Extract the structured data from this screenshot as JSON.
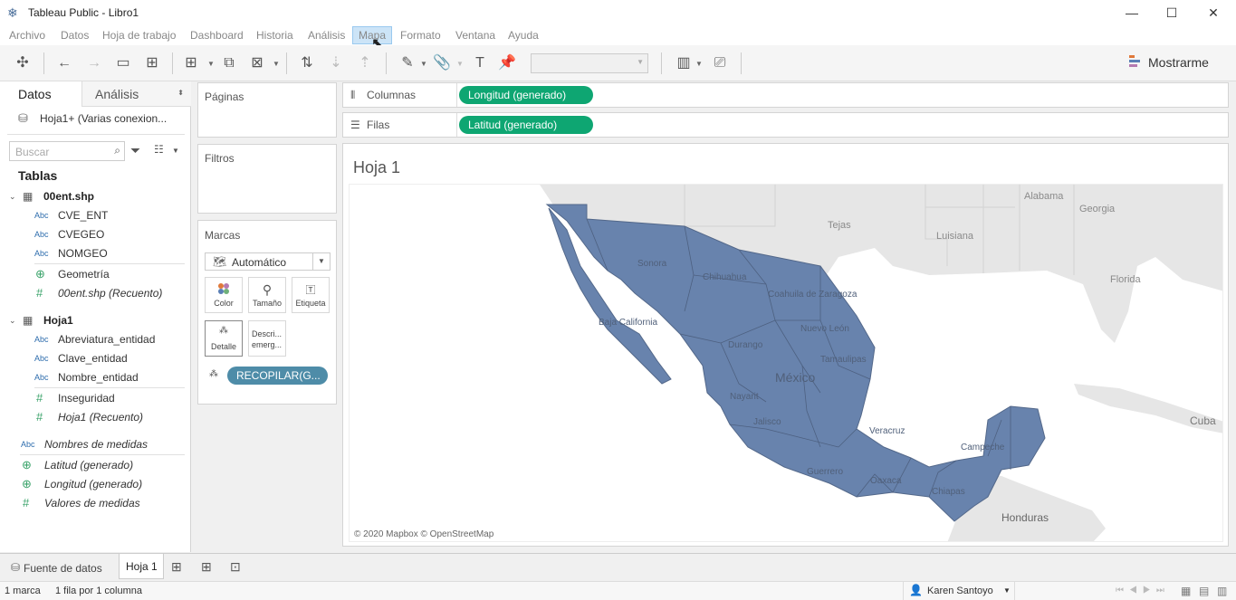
{
  "window": {
    "title": "Tableau Public - Libro1",
    "minimize": "—",
    "maximize": "☐",
    "close": "✕"
  },
  "menu": [
    "Archivo",
    "Datos",
    "Hoja de trabajo",
    "Dashboard",
    "Historia",
    "Análisis",
    "Mapa",
    "Formato",
    "Ventana",
    "Ayuda"
  ],
  "toolbar": {
    "show_me": "Mostrarme"
  },
  "left": {
    "tab_data": "Datos",
    "tab_analysis": "Análisis",
    "datasource": "Hoja1+ (Varias conexion...",
    "search_placeholder": "Buscar",
    "tables_header": "Tablas",
    "table1": {
      "name": "00ent.shp",
      "fields": [
        "CVE_ENT",
        "CVEGEO",
        "NOMGEO"
      ],
      "geo": "Geometría",
      "count": "00ent.shp (Recuento)"
    },
    "table2": {
      "name": "Hoja1",
      "fields": [
        "Abreviatura_entidad",
        "Clave_entidad",
        "Nombre_entidad"
      ],
      "measure": "Inseguridad",
      "count": "Hoja1 (Recuento)"
    },
    "measure_names": "Nombres de medidas",
    "lat": "Latitud (generado)",
    "lon": "Longitud (generado)",
    "measure_values": "Valores de medidas"
  },
  "shelves": {
    "pages": "Páginas",
    "filters": "Filtros",
    "marks": "Marcas",
    "mark_type": "Automático",
    "color": "Color",
    "size": "Tamaño",
    "label": "Etiqueta",
    "detail": "Detalle",
    "tooltip": "Descri... emerg...",
    "detail_pill": "RECOPILAR(G...",
    "columns": "Columnas",
    "rows": "Filas",
    "columns_pill": "Longitud (generado)",
    "rows_pill": "Latitud (generado)"
  },
  "view": {
    "title": "Hoja 1",
    "attribution": "© 2020 Mapbox © OpenStreetMap",
    "map_labels": [
      "Tejas",
      "Luisiana",
      "Alabama",
      "Georgia",
      "Florida",
      "Cuba",
      "Honduras",
      "Chihuahua",
      "Sonora",
      "Baja California",
      "Coahuila de Zaragoza",
      "Nuevo León",
      "Durango",
      "Tamaulipas",
      "México",
      "Jalisco",
      "Veracruz",
      "Oaxaca",
      "Chiapas",
      "Campeche",
      "Guerrero",
      "Nayarit"
    ]
  },
  "tabs": {
    "datasource": "Fuente de datos",
    "sheet": "Hoja 1"
  },
  "status": {
    "marks": "1 marca",
    "rows_cols": "1 fila por 1 columna",
    "user": "Karen Santoyo"
  },
  "colors": {
    "mexico": "#6883ad",
    "land": "#e6e6e6",
    "water": "#ffffff",
    "pill_green": "#0ea672",
    "pill_blue": "#4e8ca8"
  }
}
